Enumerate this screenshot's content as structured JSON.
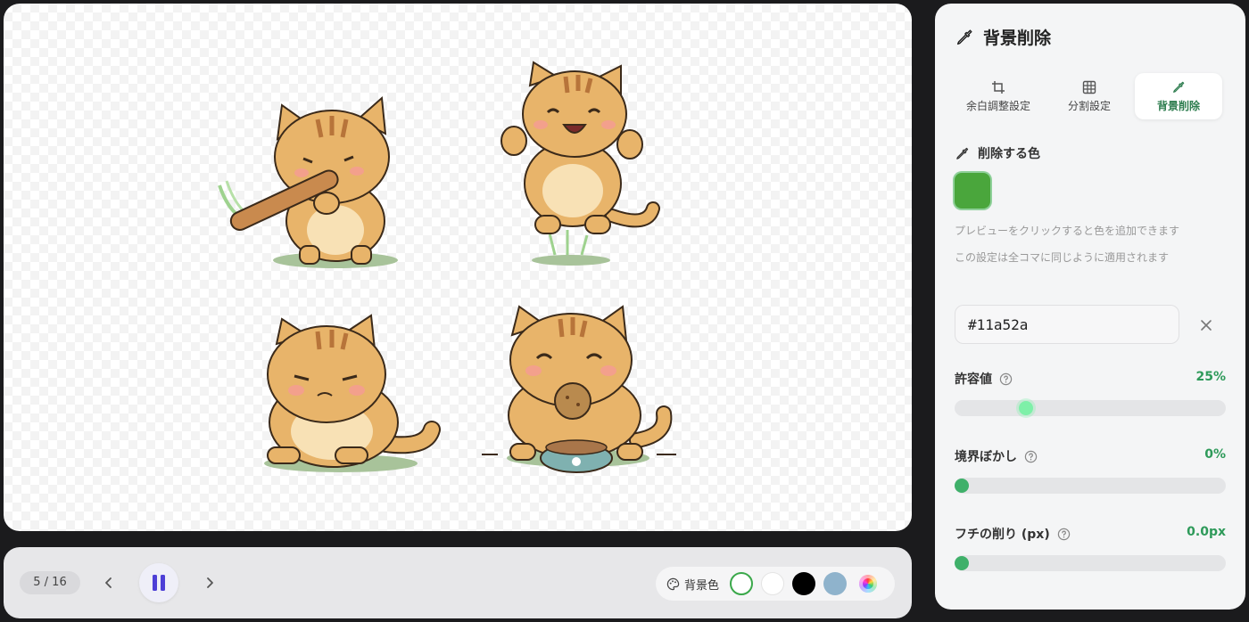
{
  "preview": {
    "cats": [
      "cat-swinging-bat",
      "cat-jumping-happy",
      "cat-sitting-sad",
      "cat-eating-cookie"
    ]
  },
  "controls": {
    "counter": "5 / 16",
    "bg_label": "背景色",
    "swatches": [
      "#ffffff",
      "#ffffff",
      "#000000",
      "#8fb3cc"
    ]
  },
  "panel": {
    "title": "背景削除",
    "tabs": [
      {
        "label": "余白調整設定",
        "icon": "crop-icon"
      },
      {
        "label": "分割設定",
        "icon": "grid-icon"
      },
      {
        "label": "背景削除",
        "icon": "eyedropper-icon"
      }
    ],
    "active_tab": 2,
    "remove_color_label": "削除する色",
    "selected_color": "#4aa63c",
    "hint1": "プレビューをクリックすると色を追加できます",
    "hint2": "この設定は全コマに同じように適用されます",
    "hex_value": "#11a52a",
    "sliders": [
      {
        "label": "許容値",
        "value": "25%",
        "fraction": 0.25
      },
      {
        "label": "境界ぼかし",
        "value": "0%",
        "fraction": 0
      },
      {
        "label": "フチの削り (px)",
        "value": "0.0px",
        "fraction": 0
      }
    ]
  }
}
